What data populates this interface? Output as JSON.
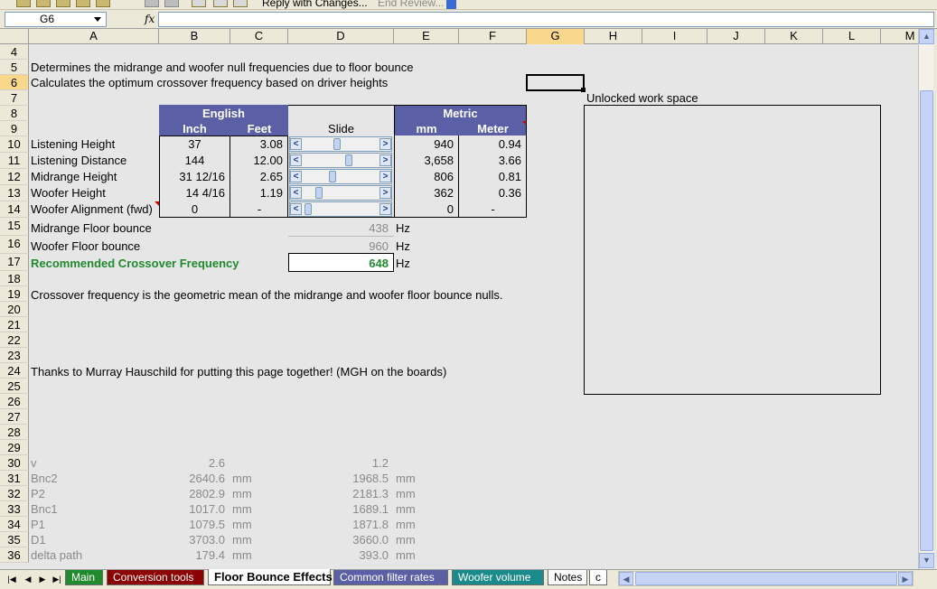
{
  "toolbar": {
    "reply_label": "Reply with Changes...",
    "review_label": "End Review..."
  },
  "formula_bar": {
    "name_box": "G6",
    "fx": "fx",
    "formula": ""
  },
  "columns": [
    "A",
    "B",
    "C",
    "D",
    "E",
    "F",
    "G",
    "H",
    "I",
    "J",
    "K",
    "L",
    "M"
  ],
  "selected_column": "G",
  "rows": [
    "4",
    "5",
    "6",
    "7",
    "8",
    "9",
    "10",
    "11",
    "12",
    "13",
    "14",
    "15",
    "16",
    "17",
    "18",
    "19",
    "20",
    "21",
    "22",
    "23",
    "24",
    "25",
    "26",
    "27",
    "28",
    "29",
    "30",
    "31",
    "32",
    "33",
    "34",
    "35",
    "36"
  ],
  "selected_row": "6",
  "sheet": {
    "desc1": "Determines the midrange and woofer null frequencies due to floor bounce",
    "desc2": "Calculates the optimum crossover frequency based on driver heights",
    "unlocked_label": "Unlocked work space",
    "english_header": "English",
    "metric_header": "Metric",
    "inch_header": "Inch",
    "feet_header": "Feet",
    "slide_header": "Slide",
    "mm_header": "mm",
    "meter_header": "Meter",
    "inputs": [
      {
        "label": "Listening Height",
        "inch": "37",
        "feet": "3.08",
        "mm": "940",
        "meter": "0.94",
        "slider": 0.45
      },
      {
        "label": "Listening Distance",
        "inch": "144",
        "feet": "12.00",
        "mm": "3,658",
        "meter": "3.66",
        "slider": 0.62
      },
      {
        "label": "Midrange Height",
        "inch": "31 12/16",
        "feet": "2.65",
        "mm": "806",
        "meter": "0.81",
        "slider": 0.38
      },
      {
        "label": "Woofer Height",
        "inch": "14  4/16",
        "feet": "1.19",
        "mm": "362",
        "meter": "0.36",
        "slider": 0.18
      },
      {
        "label": "Woofer Alignment (fwd)",
        "inch": "0",
        "feet": "-",
        "mm": "0",
        "meter": "-",
        "slider": 0.02
      }
    ],
    "midrange_bounce_label": "Midrange Floor bounce",
    "midrange_bounce_value": "438",
    "woofer_bounce_label": "Woofer Floor bounce",
    "woofer_bounce_value": "960",
    "hz": "Hz",
    "crossover_label": "Recommended Crossover Frequency",
    "crossover_value": "648",
    "note1": "Crossover frequency is the geometric mean of the midrange and woofer floor bounce nulls.",
    "note2": "Thanks to Murray Hauschild for putting this page together!  (MGH on the boards)",
    "calc_rows": [
      {
        "label": "v",
        "b": "2.6",
        "c": "",
        "d": "1.2",
        "e": ""
      },
      {
        "label": "Bnc2",
        "b": "2640.6",
        "c": "mm",
        "d": "1968.5",
        "e": "mm"
      },
      {
        "label": "P2",
        "b": "2802.9",
        "c": "mm",
        "d": "2181.3",
        "e": "mm"
      },
      {
        "label": "Bnc1",
        "b": "1017.0",
        "c": "mm",
        "d": "1689.1",
        "e": "mm"
      },
      {
        "label": "P1",
        "b": "1079.5",
        "c": "mm",
        "d": "1871.8",
        "e": "mm"
      },
      {
        "label": "D1",
        "b": "3703.0",
        "c": "mm",
        "d": "3660.0",
        "e": "mm"
      },
      {
        "label": "delta path",
        "b": "179.4",
        "c": "mm",
        "d": "393.0",
        "e": "mm"
      }
    ]
  },
  "tabs": [
    {
      "label": "Main",
      "color": "#1f8a2e"
    },
    {
      "label": "Conversion tools",
      "color": "#8b0000"
    },
    {
      "label": "Floor Bounce Effects",
      "color": "#ffffff"
    },
    {
      "label": "Common filter rates",
      "color": "#5b5fa6"
    },
    {
      "label": "Woofer volume",
      "color": "#1a8a8a"
    },
    {
      "label": "Notes",
      "color": "#ffffff"
    },
    {
      "label": "c",
      "color": "#ffffff"
    }
  ],
  "colors": {
    "header_blue": "#5b5fa6",
    "crossover_green": "#1f8a2e",
    "selection": "#f9d78b"
  }
}
